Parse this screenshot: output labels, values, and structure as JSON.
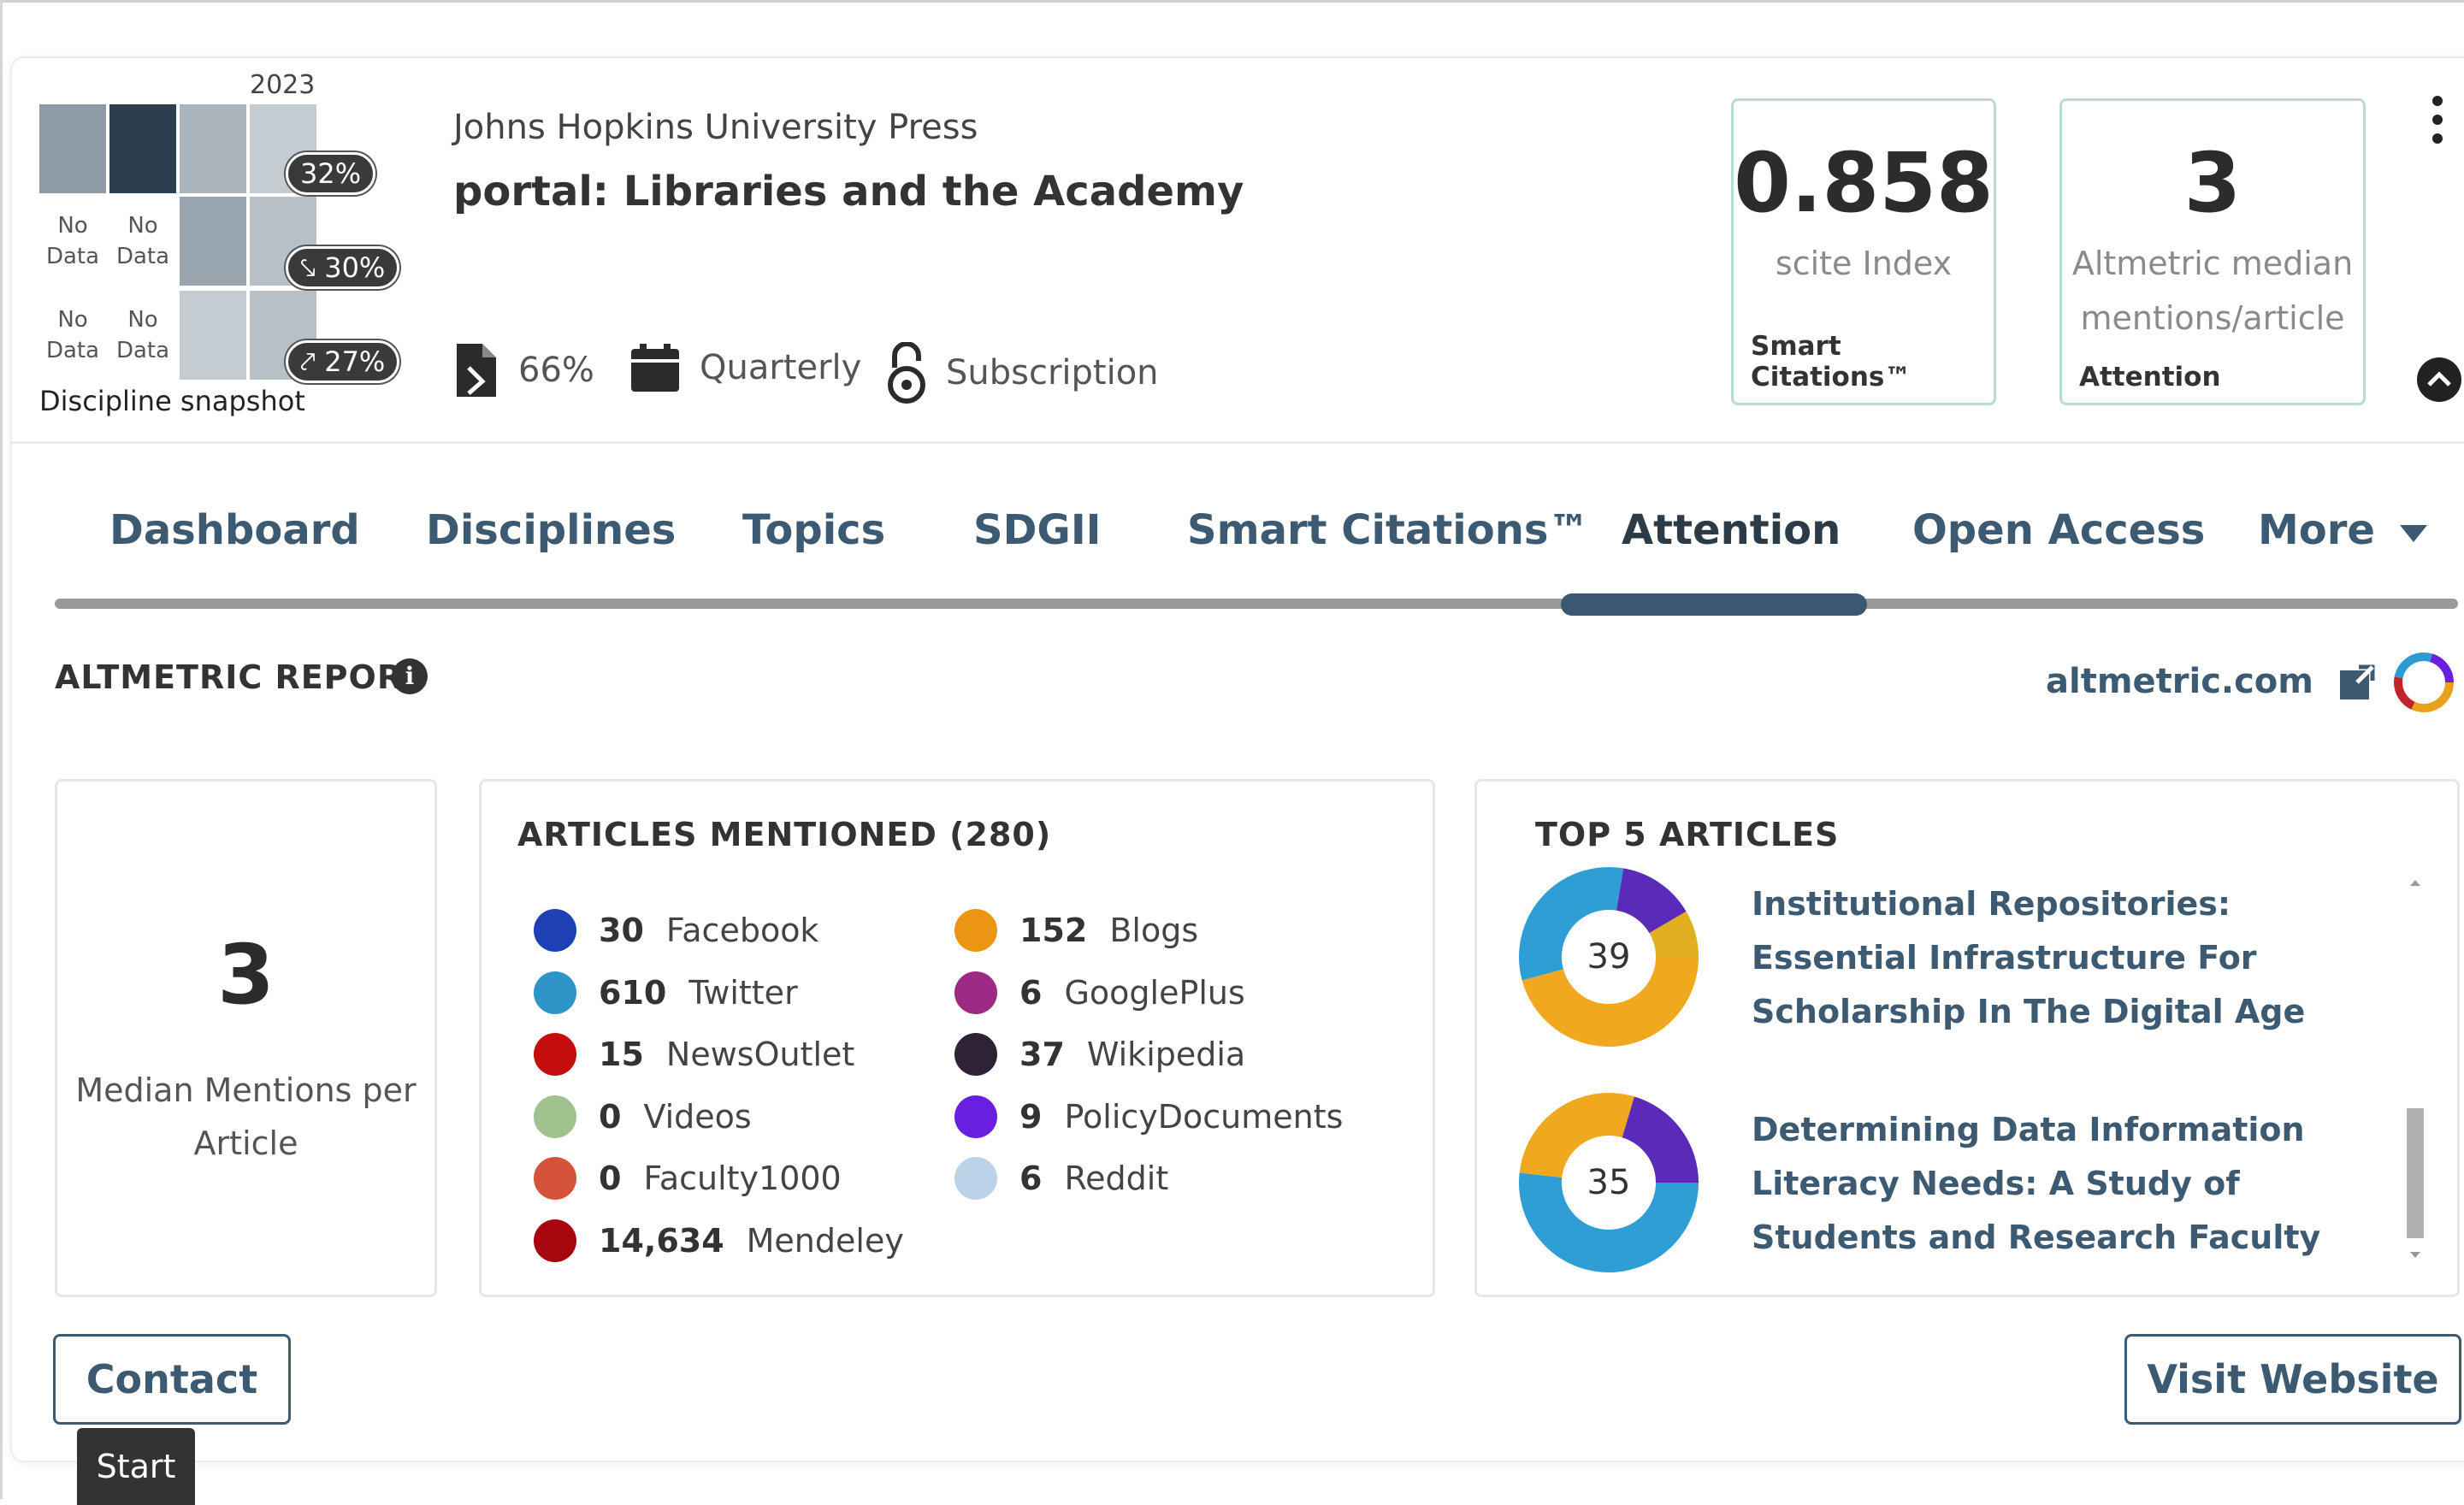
{
  "header": {
    "snapshot": {
      "year": "2023",
      "label": "Discipline snapshot",
      "no_data": "No\nData",
      "pills": [
        "32%",
        "30%",
        "27%"
      ]
    },
    "publisher": "Johns Hopkins University Press",
    "journal": "portal: Libraries and the Academy",
    "meta": {
      "oa_percent": "66%",
      "frequency": "Quarterly",
      "model": "Subscription"
    },
    "stats": [
      {
        "value": "0.858",
        "label": "scite Index",
        "footer": "Smart Citations™"
      },
      {
        "value": "3",
        "label": "Altmetric median mentions/article",
        "footer": "Attention"
      }
    ]
  },
  "tabs": [
    "Dashboard",
    "Disciplines",
    "Topics",
    "SDGII",
    "Smart Citations™",
    "Attention",
    "Open Access",
    "More"
  ],
  "active_tab": "Attention",
  "report": {
    "title": "ALTMETRIC REPORT",
    "link": "altmetric.com",
    "median": {
      "value": "3",
      "label": "Median Mentions per Article"
    },
    "articles_mentioned": {
      "title": "ARTICLES MENTIONED (280)",
      "left": [
        {
          "count": "30",
          "name": "Facebook",
          "color": "#1f3fb5"
        },
        {
          "count": "610",
          "name": "Twitter",
          "color": "#2f95c8"
        },
        {
          "count": "15",
          "name": "NewsOutlet",
          "color": "#c60d0d"
        },
        {
          "count": "0",
          "name": "Videos",
          "color": "#9fc28f"
        },
        {
          "count": "0",
          "name": "Faculty1000",
          "color": "#d4533a"
        },
        {
          "count": "14,634",
          "name": "Mendeley",
          "color": "#a8060f"
        }
      ],
      "right": [
        {
          "count": "152",
          "name": "Blogs",
          "color": "#eb9512"
        },
        {
          "count": "6",
          "name": "GooglePlus",
          "color": "#9c2a84"
        },
        {
          "count": "37",
          "name": "Wikipedia",
          "color": "#2e2236"
        },
        {
          "count": "9",
          "name": "PolicyDocuments",
          "color": "#6a1fe0"
        },
        {
          "count": "6",
          "name": "Reddit",
          "color": "#bcd2e8"
        }
      ]
    },
    "top_articles": {
      "title": "TOP 5 ARTICLES",
      "items": [
        {
          "score": "39",
          "title": "Institutional Repositories: Essential Infrastructure For Scholarship In The Digital Age"
        },
        {
          "score": "35",
          "title": "Determining Data Information Literacy Needs: A Study of Students and Research Faculty"
        }
      ]
    }
  },
  "buttons": {
    "contact": "Contact",
    "visit": "Visit Website"
  },
  "tooltip": "Start"
}
